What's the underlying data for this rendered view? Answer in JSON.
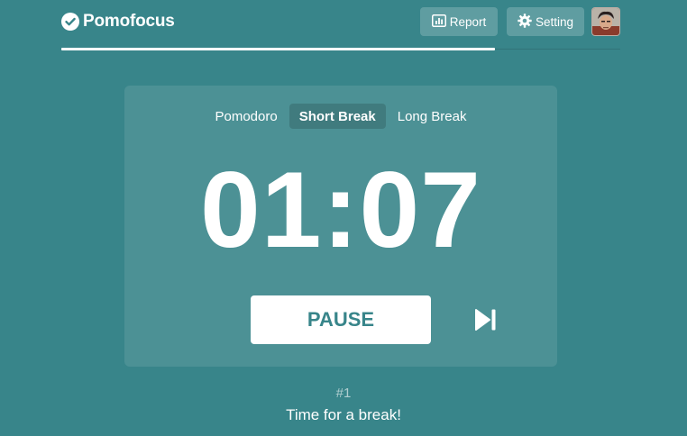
{
  "header": {
    "app_name": "Pomofocus",
    "logo_icon": "check-circle-icon",
    "report_label": "Report",
    "report_icon": "bar-chart-icon",
    "setting_label": "Setting",
    "setting_icon": "gear-icon",
    "avatar_icon": "user-avatar"
  },
  "progress": {
    "fraction": 0.776
  },
  "timer": {
    "modes": [
      {
        "label": "Pomodoro",
        "active": false
      },
      {
        "label": "Short Break",
        "active": true
      },
      {
        "label": "Long Break",
        "active": false
      }
    ],
    "time": "01:07",
    "pause_label": "PAUSE",
    "skip_icon": "skip-next-icon"
  },
  "footer": {
    "counter": "#1",
    "message": "Time for a break!"
  },
  "colors": {
    "background": "#38858a",
    "accent": "#ffffff"
  }
}
